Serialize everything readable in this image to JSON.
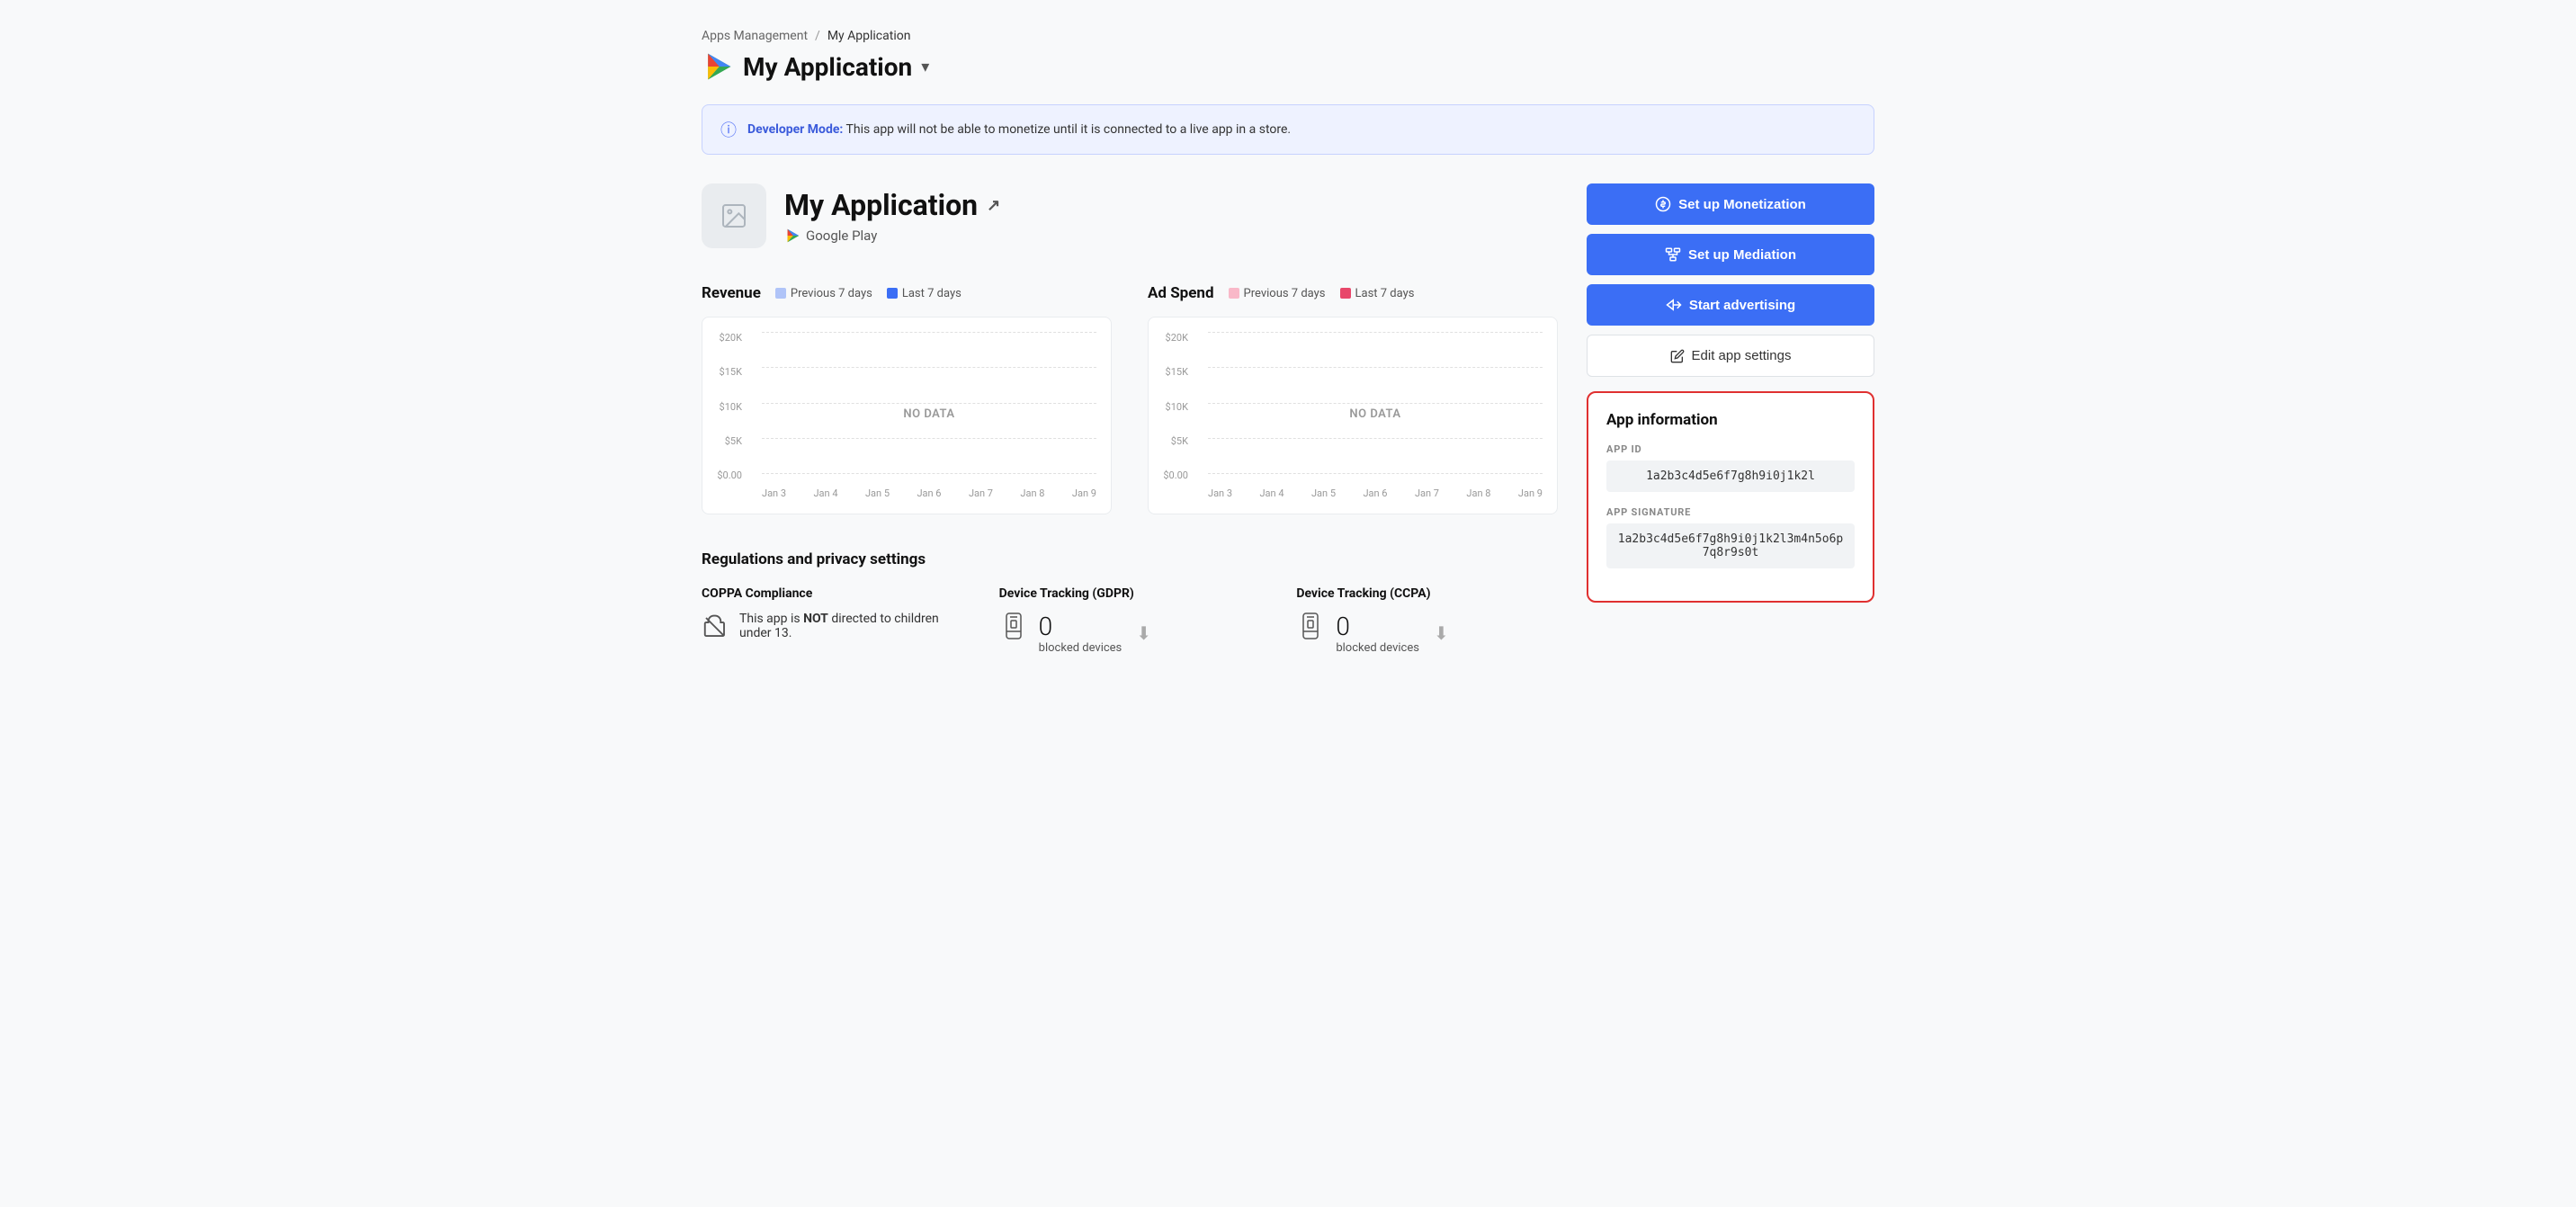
{
  "breadcrumb": {
    "parent": "Apps Management",
    "separator": "/",
    "current": "My Application"
  },
  "header": {
    "title": "My Application",
    "dropdown_arrow": "▾"
  },
  "dev_banner": {
    "label": "Developer Mode:",
    "message": "This app will not be able to monetize until it is connected to a live app in a store."
  },
  "app": {
    "name": "My Application",
    "platform": "Google Play"
  },
  "revenue_chart": {
    "title": "Revenue",
    "legend": [
      {
        "label": "Previous 7 days",
        "color": "#b0c4f8"
      },
      {
        "label": "Last 7 days",
        "color": "#3b6ef5"
      }
    ],
    "y_labels": [
      "$20K",
      "$15K",
      "$10K",
      "$5K",
      "$0.00"
    ],
    "no_data": "NO DATA",
    "x_labels": [
      "Jan 3",
      "Jan 4",
      "Jan 5",
      "Jan 6",
      "Jan 7",
      "Jan 8",
      "Jan 9"
    ]
  },
  "adspend_chart": {
    "title": "Ad Spend",
    "legend": [
      {
        "label": "Previous 7 days",
        "color": "#f9b8c8"
      },
      {
        "label": "Last 7 days",
        "color": "#e8476a"
      }
    ],
    "y_labels": [
      "$20K",
      "$15K",
      "$10K",
      "$5K",
      "$0.00"
    ],
    "no_data": "NO DATA",
    "x_labels": [
      "Jan 3",
      "Jan 4",
      "Jan 5",
      "Jan 6",
      "Jan 7",
      "Jan 8",
      "Jan 9"
    ]
  },
  "buttons": {
    "setup_monetization": "Set up Monetization",
    "setup_mediation": "Set up Mediation",
    "start_advertising": "Start advertising",
    "edit_app_settings": "Edit app settings"
  },
  "app_information": {
    "title": "App information",
    "app_id_label": "APP ID",
    "app_id_value": "1a2b3c4d5e6f7g8h9i0j1k2l",
    "app_signature_label": "APP SIGNATURE",
    "app_signature_value": "1a2b3c4d5e6f7g8h9i0j1k2l3m4n5o6p7q8r9s0t"
  },
  "privacy": {
    "section_title": "Regulations and privacy settings",
    "coppa": {
      "title": "COPPA Compliance",
      "description": "This app is NOT directed to children under 13."
    },
    "gdpr": {
      "title": "Device Tracking (GDPR)",
      "count": "0",
      "label": "blocked devices"
    },
    "ccpa": {
      "title": "Device Tracking (CCPA)",
      "count": "0",
      "label": "blocked devices"
    }
  }
}
